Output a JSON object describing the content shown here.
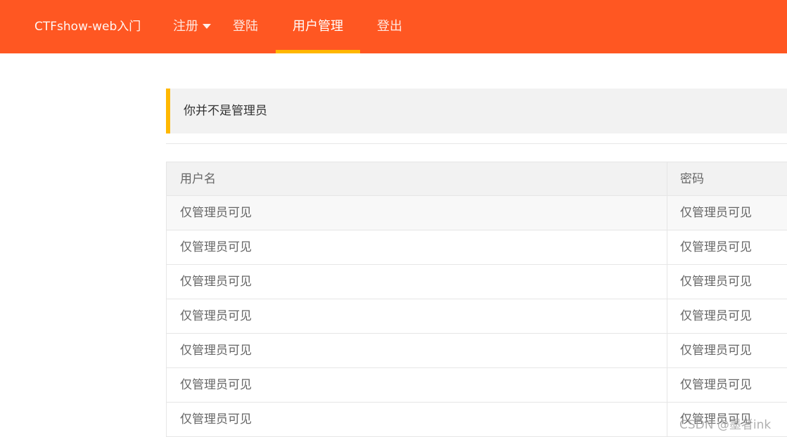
{
  "nav": {
    "brand": "CTFshow-web入门",
    "items": [
      {
        "label": "注册",
        "has_dropdown": true,
        "active": false
      },
      {
        "label": "登陆",
        "has_dropdown": false,
        "active": false
      },
      {
        "label": "用户管理",
        "has_dropdown": false,
        "active": true
      },
      {
        "label": "登出",
        "has_dropdown": false,
        "active": false
      }
    ]
  },
  "notice": {
    "text": "你并不是管理员"
  },
  "table": {
    "columns": [
      "用户名",
      "密码"
    ],
    "rows": [
      [
        "仅管理员可见",
        "仅管理员可见"
      ],
      [
        "仅管理员可见",
        "仅管理员可见"
      ],
      [
        "仅管理员可见",
        "仅管理员可见"
      ],
      [
        "仅管理员可见",
        "仅管理员可见"
      ],
      [
        "仅管理员可见",
        "仅管理员可见"
      ],
      [
        "仅管理员可见",
        "仅管理员可见"
      ],
      [
        "仅管理员可见",
        "仅管理员可见"
      ]
    ]
  },
  "watermark": "CSDN @墨者ink",
  "colors": {
    "nav_bg": "#ff5722",
    "accent": "#ffb800",
    "header_bg": "#f2f2f2"
  }
}
